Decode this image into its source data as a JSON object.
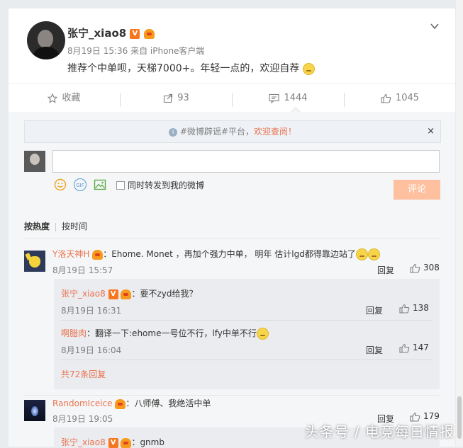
{
  "post": {
    "username": "张宁_xiao8",
    "meta": "8月19日 15:36 来自 iPhone客户端",
    "text": "推荐个中单呗，天梯7000+。年轻一点的，欢迎自荐"
  },
  "actions": {
    "favorite": "收藏",
    "forward": "93",
    "comment": "1444",
    "like": "1045"
  },
  "notice": {
    "prefix": "#微博辟谣#平台，",
    "link": "欢迎查阅！",
    "close": "×"
  },
  "composer": {
    "gif_label": "GIF",
    "forward_checkbox_label": "同时转发到我的微博",
    "submit_label": "评论"
  },
  "sort": {
    "hot": "按热度",
    "time": "按时间"
  },
  "comments": [
    {
      "user": "Y洛天神H",
      "text": "：Ehome. Monet ，再加个强力中单， 明年 估计lgd都得靠边站了",
      "time": "8月19日 15:57",
      "reply": "回复",
      "likes": "308",
      "sub_replies": [
        {
          "user": "张宁_xiao8",
          "text": "：要不zyd给我？",
          "time": "8月19日 16:31",
          "reply": "回复",
          "likes": "138"
        },
        {
          "user": "啊腊肉",
          "text": "：翻译一下:ehome一号位不行，lfy中单不行",
          "time": "8月19日 16:04",
          "reply": "回复",
          "likes": "147"
        }
      ],
      "more": "共72条回复"
    },
    {
      "user": "RandomIceice",
      "text": "：八师傅、我绝活中单",
      "time": "8月19日 19:05",
      "reply": "回复",
      "likes": "179",
      "sub_replies": [
        {
          "user": "张宁_xiao8",
          "text": "：gnmb"
        }
      ]
    }
  ],
  "watermark": "头条号 / 电竞每日情报",
  "colors": {
    "accent": "#eb7350",
    "link_blue": "#4a90c8",
    "submit_disabled": "#ffc09f"
  }
}
